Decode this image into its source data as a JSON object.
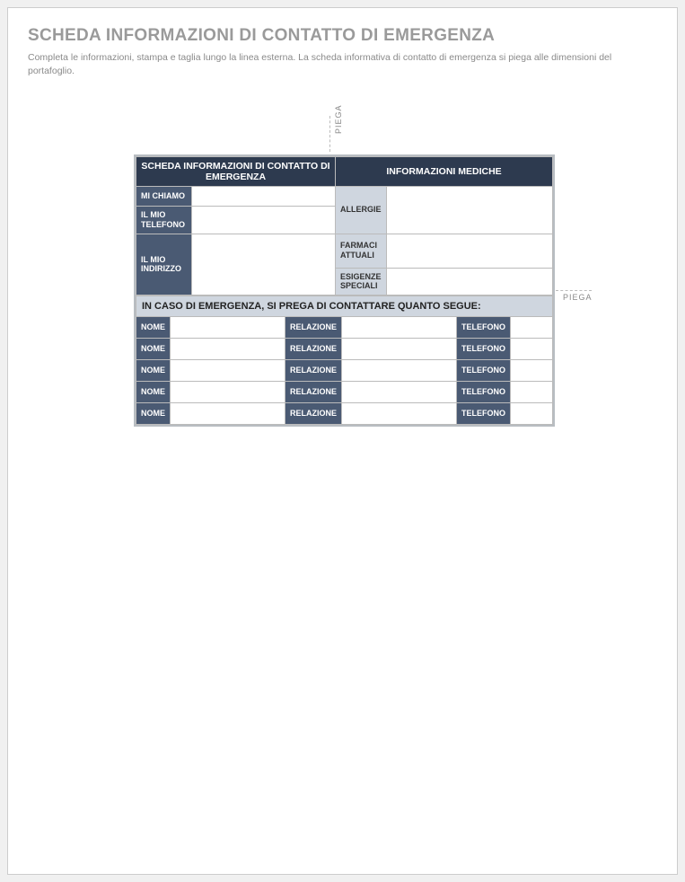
{
  "title": "SCHEDA INFORMAZIONI DI CONTATTO DI EMERGENZA",
  "subtitle": "Completa le informazioni, stampa e taglia lungo la linea esterna.  La scheda informativa di contatto di emergenza si piega alle dimensioni del portafoglio.",
  "fold_label": "PIEGA",
  "card": {
    "left_header": "SCHEDA INFORMAZIONI DI CONTATTO DI EMERGENZA",
    "right_header": "INFORMAZIONI MEDICHE",
    "labels": {
      "name": "MI CHIAMO",
      "phone": "IL MIO TELEFONO",
      "address": "IL MIO INDIRIZZO",
      "allergies": "ALLERGIE",
      "meds": "FARMACI ATTUALI",
      "special": "ESIGENZE SPECIALI"
    },
    "values": {
      "name": "",
      "phone": "",
      "address": "",
      "allergies": "",
      "meds": "",
      "special": ""
    },
    "emergency_header": "IN CASO DI EMERGENZA, SI PREGA DI CONTATTARE QUANTO SEGUE:",
    "col": {
      "name": "NOME",
      "relation": "RELAZIONE",
      "phone": "TELEFONO"
    },
    "contacts": [
      {
        "name": "",
        "relation": "",
        "phone": ""
      },
      {
        "name": "",
        "relation": "",
        "phone": ""
      },
      {
        "name": "",
        "relation": "",
        "phone": ""
      },
      {
        "name": "",
        "relation": "",
        "phone": ""
      },
      {
        "name": "",
        "relation": "",
        "phone": ""
      }
    ]
  }
}
